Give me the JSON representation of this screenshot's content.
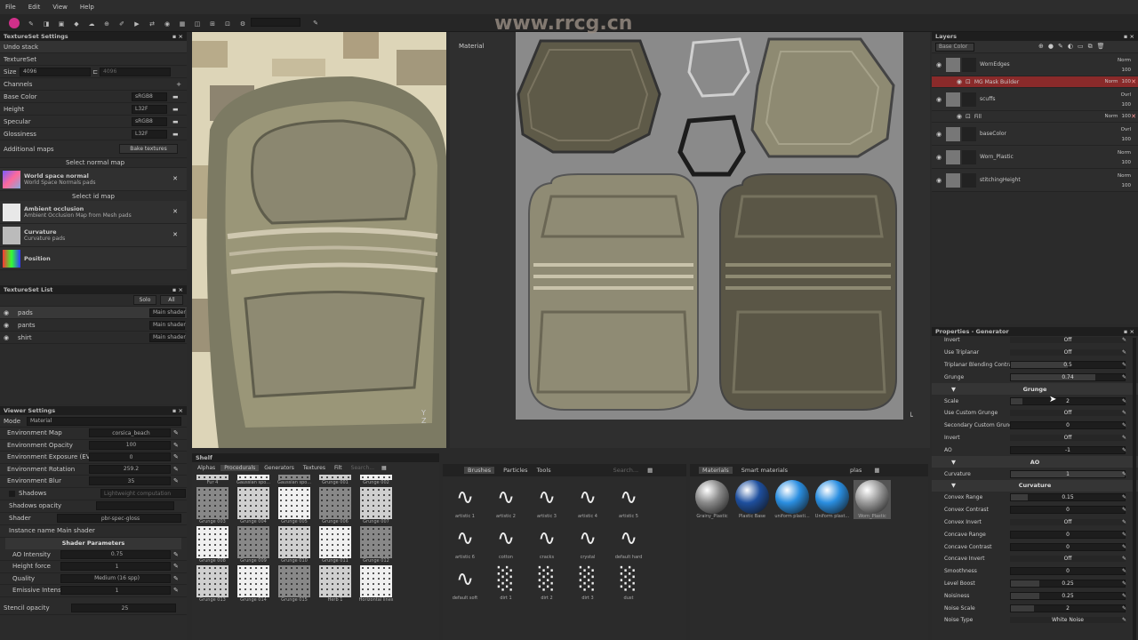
{
  "menu": [
    "File",
    "Edit",
    "View",
    "Help"
  ],
  "watermark": "www.rrcg.cn",
  "textureset_settings": {
    "title": "TextureSet Settings",
    "undo": "Undo stack",
    "textureset": "TextureSet",
    "size_label": "Size",
    "size_value": "4096",
    "size_value2": "4096",
    "channels": "Channels",
    "channel_rows": [
      {
        "name": "Base Color",
        "format": "sRGB8"
      },
      {
        "name": "Height",
        "format": "L32F"
      },
      {
        "name": "Specular",
        "format": "sRGB8"
      },
      {
        "name": "Glossiness",
        "format": "L32F"
      }
    ],
    "additional_maps": "Additional maps",
    "bake": "Bake textures",
    "select_normal": "Select normal map",
    "maps": [
      {
        "title": "World space normal",
        "sub": "World Space Normals pads"
      },
      {
        "title": "Ambient occlusion",
        "sub": "Ambient Occlusion Map from Mesh pads"
      },
      {
        "title": "Curvature",
        "sub": "Curvature pads"
      },
      {
        "title": "Position",
        "sub": ""
      }
    ],
    "select_id": "Select id map"
  },
  "textureset_list": {
    "title": "TextureSet List",
    "solo": "Solo",
    "all": "All",
    "items": [
      {
        "name": "pads",
        "shader": "Main shader"
      },
      {
        "name": "pants",
        "shader": "Main shader"
      },
      {
        "name": "shirt",
        "shader": "Main shader"
      }
    ]
  },
  "viewer_settings": {
    "title": "Viewer Settings",
    "mode_label": "Mode",
    "mode_value": "Material",
    "rows": [
      {
        "label": "Environment Map",
        "value": "corsica_beach"
      },
      {
        "label": "Environment Opacity",
        "value": "100"
      },
      {
        "label": "Environment Exposure (EV)",
        "value": "0"
      },
      {
        "label": "Environment Rotation",
        "value": "259.2"
      },
      {
        "label": "Environment Blur",
        "value": "35"
      }
    ],
    "shadows": "Shadows",
    "shadows_val": "Lightweight computation",
    "shadows_opacity": "Shadows opacity",
    "shader_label": "Shader",
    "shader_value": "pbr-spec-gloss",
    "instance_label": "Instance name",
    "instance_value": "Main shader",
    "shader_params": "Shader Parameters",
    "params": [
      {
        "label": "AO Intensity",
        "value": "0.75"
      },
      {
        "label": "Height force",
        "value": "1"
      },
      {
        "label": "Quality",
        "value": "Medium (16 spp)"
      },
      {
        "label": "Emissive Intensity",
        "value": "1"
      }
    ],
    "stencil": "Stencil opacity",
    "stencil_value": "25"
  },
  "viewport": {
    "material_label": "Material"
  },
  "shelf": {
    "title": "Shelf",
    "tabs": [
      "Alphas",
      "Procedurals",
      "Generators",
      "Textures",
      "Filt"
    ],
    "search": "Search...",
    "items": [
      "Fur 4",
      "Gaussian spo...",
      "Gaussian spo...",
      "Grunge 001",
      "Grunge 002",
      "Grunge 003",
      "Grunge 004",
      "Grunge 005",
      "Grunge 006",
      "Grunge 007",
      "Grunge 008",
      "Grunge 009",
      "Grunge 010",
      "Grunge 011",
      "Grunge 012",
      "Grunge 013",
      "Grunge 014",
      "Grunge 015",
      "Herb 1",
      "Horizontal lines"
    ]
  },
  "brushes": {
    "tabs": [
      "Brushes",
      "Particles",
      "Tools"
    ],
    "search": "Search...",
    "items": [
      "artistic 1",
      "artistic 2",
      "artistic 3",
      "artistic 4",
      "artistic 5",
      "artistic 6",
      "cotton",
      "cracks",
      "crystal",
      "default hard",
      "default soft",
      "dirt 1",
      "dirt 2",
      "dirt 3",
      "dust"
    ]
  },
  "materials": {
    "tabs": [
      "Materials",
      "Smart materials"
    ],
    "search": "plas",
    "items": [
      "Grainy_Plastic",
      "Plastic Base",
      "uniform plasti...",
      "Uniform plast...",
      "Worn_Plastic"
    ]
  },
  "layers": {
    "title": "Layers",
    "channel": "Base Color",
    "items": [
      {
        "name": "WornEdges",
        "blend": "Norm",
        "op": "100",
        "sub": false
      },
      {
        "name": "MG Mask Builder",
        "blend": "Norm",
        "op": "100",
        "sub": true,
        "active": true
      },
      {
        "name": "scuffs",
        "blend": "Ovrl",
        "op": "100",
        "sub": false
      },
      {
        "name": "Fill",
        "blend": "Norm",
        "op": "100",
        "sub": true
      },
      {
        "name": "baseColor",
        "blend": "Ovrl",
        "op": "100",
        "sub": false
      },
      {
        "name": "Worn_Plastic",
        "blend": "Norm",
        "op": "100",
        "sub": false
      },
      {
        "name": "stitchingHeight",
        "blend": "Norm",
        "op": "100",
        "sub": false
      }
    ]
  },
  "properties": {
    "title": "Properties - Generator",
    "top_rows": [
      {
        "label": "Invert",
        "value": "Off",
        "type": "toggle"
      },
      {
        "label": "Use Triplanar",
        "value": "Off",
        "type": "toggle"
      },
      {
        "label": "Triplanar Blending Contrast",
        "value": "0.5",
        "type": "slider",
        "pct": 0.5
      },
      {
        "label": "Grunge",
        "value": "0.74",
        "type": "slider",
        "pct": 0.74
      }
    ],
    "grunge_title": "Grunge",
    "grunge_rows": [
      {
        "label": "Scale",
        "value": "2",
        "type": "slider",
        "pct": 0.1
      },
      {
        "label": "Use Custom Grunge",
        "value": "Off",
        "type": "toggle"
      },
      {
        "label": "Secondary Custom Grunge",
        "value": "0",
        "type": "slider",
        "pct": 0
      },
      {
        "label": "Invert",
        "value": "Off",
        "type": "toggle"
      }
    ],
    "ao_label": "AO",
    "ao_value": "-1",
    "ao_title": "AO",
    "curv_label": "Curvature",
    "curv_value": "1",
    "curv_title": "Curvature",
    "curv_rows": [
      {
        "label": "Convex Range",
        "value": "0.15",
        "type": "slider",
        "pct": 0.15
      },
      {
        "label": "Convex Contrast",
        "value": "0",
        "type": "slider",
        "pct": 0
      },
      {
        "label": "Convex Invert",
        "value": "Off",
        "type": "toggle"
      },
      {
        "label": "Concave Range",
        "value": "0",
        "type": "slider",
        "pct": 0
      },
      {
        "label": "Concave Contrast",
        "value": "0",
        "type": "slider",
        "pct": 0
      },
      {
        "label": "Concave Invert",
        "value": "Off",
        "type": "toggle"
      },
      {
        "label": "Smoothness",
        "value": "0",
        "type": "slider",
        "pct": 0
      },
      {
        "label": "Level Boost",
        "value": "0.25",
        "type": "slider",
        "pct": 0.25
      },
      {
        "label": "Noisiness",
        "value": "0.25",
        "type": "slider",
        "pct": 0.25
      },
      {
        "label": "Noise Scale",
        "value": "2",
        "type": "slider",
        "pct": 0.2
      },
      {
        "label": "Noise Type",
        "value": "White Noise",
        "type": "toggle"
      }
    ]
  }
}
